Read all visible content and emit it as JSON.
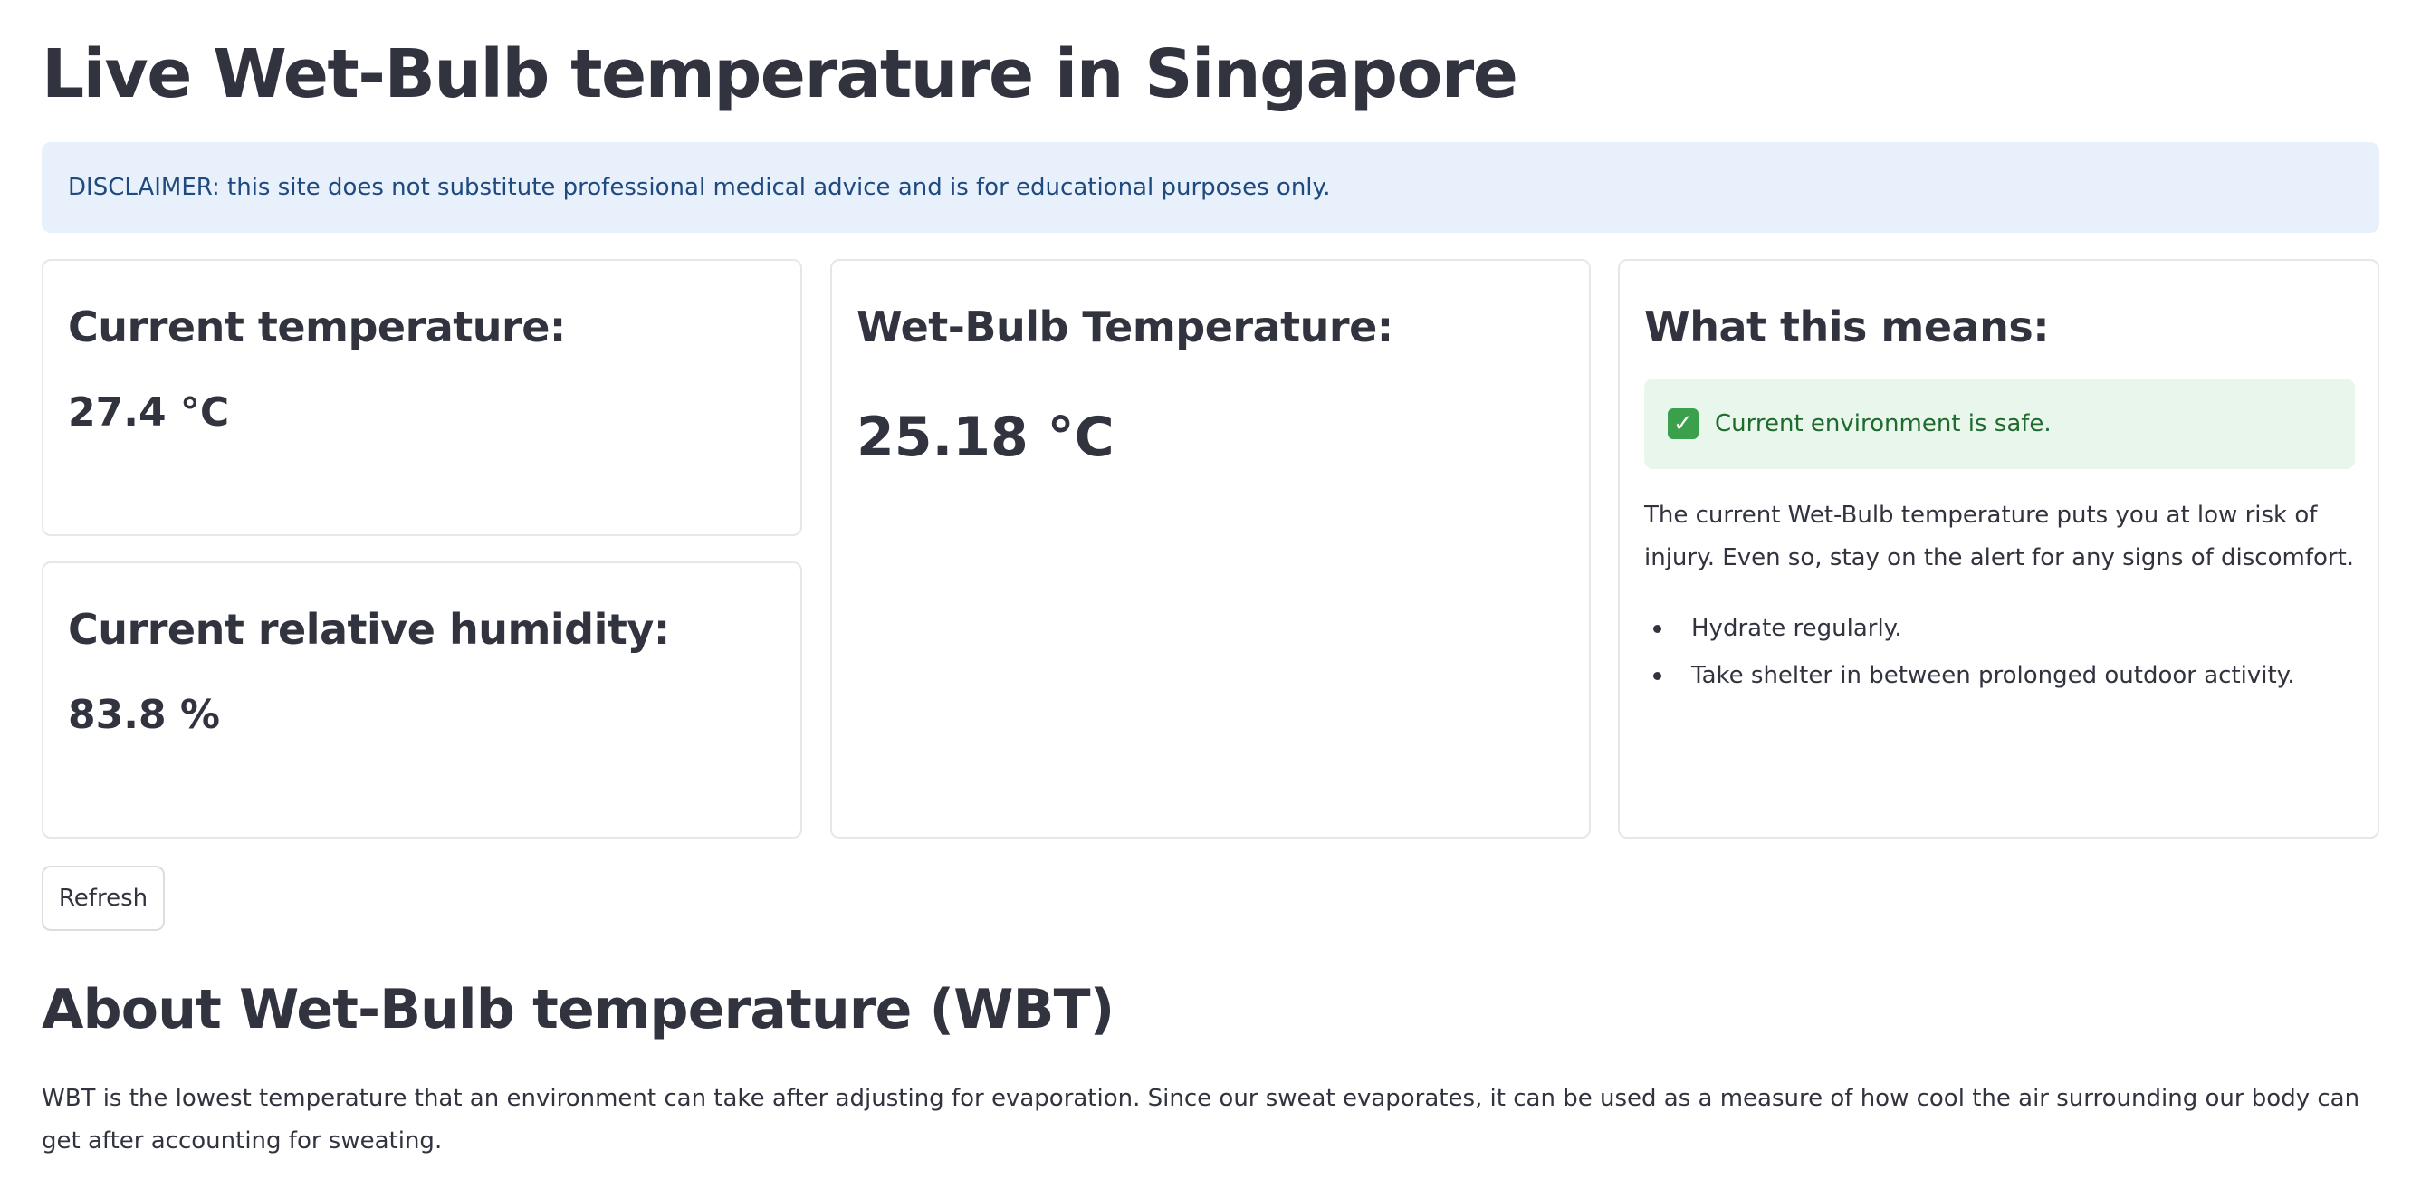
{
  "page": {
    "title": "Live Wet-Bulb temperature in Singapore"
  },
  "disclaimer": {
    "text": "DISCLAIMER: this site does not substitute professional medical advice and is for educational purposes only."
  },
  "cards": {
    "temperature": {
      "heading": "Current temperature:",
      "value": "27.4 °C"
    },
    "humidity": {
      "heading": "Current relative humidity:",
      "value": "83.8 %"
    },
    "wet_bulb": {
      "heading": "Wet-Bulb Temperature:",
      "value": "25.18 °C"
    },
    "meaning": {
      "heading": "What this means:",
      "status_icon": "check-mark-icon",
      "status_text": "Current environment is safe.",
      "description": "The current Wet-Bulb temperature puts you at low risk of injury. Even so, stay on the alert for any signs of discomfort.",
      "tips": [
        "Hydrate regularly.",
        "Take shelter in between prolonged outdoor activity."
      ]
    }
  },
  "actions": {
    "refresh_label": "Refresh"
  },
  "about": {
    "title": "About Wet-Bulb temperature (WBT)",
    "text": "WBT is the lowest temperature that an environment can take after adjusting for evaporation. Since our sweat evaporates, it can be used as a measure of how cool the air surrounding our body can get after accounting for sweating."
  },
  "colors": {
    "info_background": "#e8f1fb",
    "info_text": "#1f4a80",
    "success_background": "#e9f6ec",
    "success_text": "#1f6b2e",
    "success_icon": "#3aa04b",
    "text_primary": "#31333f",
    "card_border": "#e6e7eb"
  }
}
